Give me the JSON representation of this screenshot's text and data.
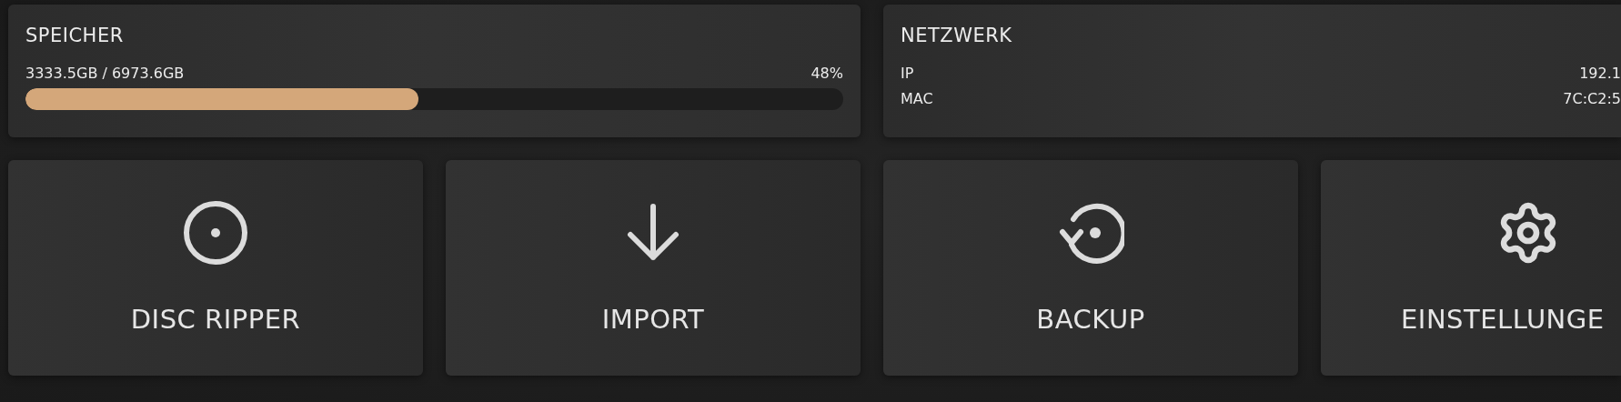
{
  "storage": {
    "title": "SPEICHER",
    "usage": "3333.5GB / 6973.6GB",
    "percent": "48%",
    "level": 0.48
  },
  "network": {
    "title": "NETZWERK",
    "rows": [
      {
        "label": "IP",
        "value": "192.1"
      },
      {
        "label": "MAC",
        "value": "7C:C2:5"
      }
    ]
  },
  "tiles": [
    {
      "kind": "disc",
      "label": "DISC RIPPER"
    },
    {
      "kind": "import",
      "label": "IMPORT"
    },
    {
      "kind": "backup",
      "label": "BACKUP"
    },
    {
      "kind": "settings",
      "label": "EINSTELLUNGE"
    }
  ]
}
